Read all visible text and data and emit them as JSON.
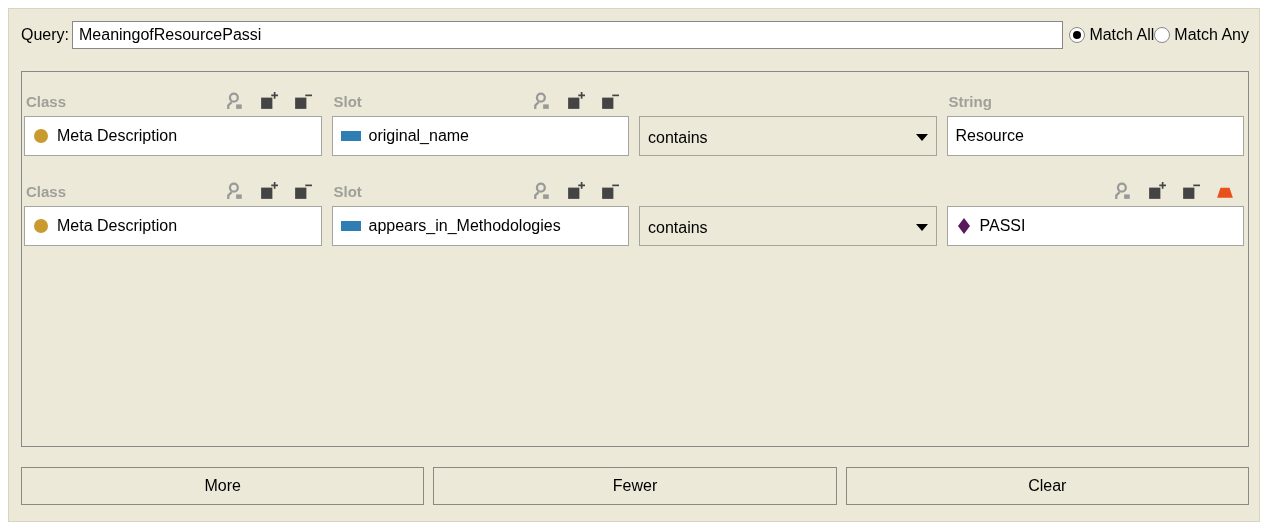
{
  "query": {
    "label": "Query:",
    "value": "MeaningofResourcePassi"
  },
  "match": [
    {
      "label": "Match All",
      "selected": true
    },
    {
      "label": "Match Any",
      "selected": false
    }
  ],
  "rows": [
    {
      "class_label": "Class",
      "class_value": "Meta Description",
      "slot_label": "Slot",
      "slot_value": "original_name",
      "operator": "contains",
      "value_header": {
        "kind": "label",
        "text": "String"
      },
      "value": {
        "kind": "text",
        "text": "Resource"
      }
    },
    {
      "class_label": "Class",
      "class_value": "Meta Description",
      "slot_label": "Slot",
      "slot_value": "appears_in_Methodologies",
      "operator": "contains",
      "value_header": {
        "kind": "icons"
      },
      "value": {
        "kind": "instance",
        "text": "PASSI"
      }
    }
  ],
  "buttons": [
    "More",
    "Fewer",
    "Clear"
  ]
}
